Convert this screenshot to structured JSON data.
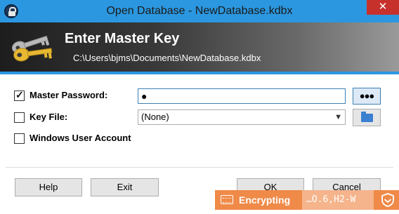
{
  "window": {
    "title": "Open Database - NewDatabase.kdbx",
    "close_glyph": "✕"
  },
  "banner": {
    "heading": "Enter Master Key",
    "path": "C:\\Users\\bjms\\Documents\\NewDatabase.kdbx"
  },
  "form": {
    "master_password": {
      "label": "Master Password:",
      "checked": true,
      "value": "●",
      "toggle_label": "●●●"
    },
    "key_file": {
      "label": "Key File:",
      "checked": false,
      "value": "(None)",
      "chevron": "▼"
    },
    "windows_account": {
      "label": "Windows User Account",
      "checked": false
    }
  },
  "buttons": {
    "help": "Help",
    "exit": "Exit",
    "ok": "OK",
    "cancel": "Cancel"
  },
  "status": {
    "label": "Encrypting",
    "params": "…O.6,H2-W"
  },
  "colors": {
    "titlebar": "#2b97e0",
    "close": "#c7312c",
    "accent_orange": "#ef8a48"
  },
  "icons": [
    "lock-icon",
    "keys-icon",
    "folder-icon",
    "keyboard-icon",
    "shield-icon"
  ]
}
